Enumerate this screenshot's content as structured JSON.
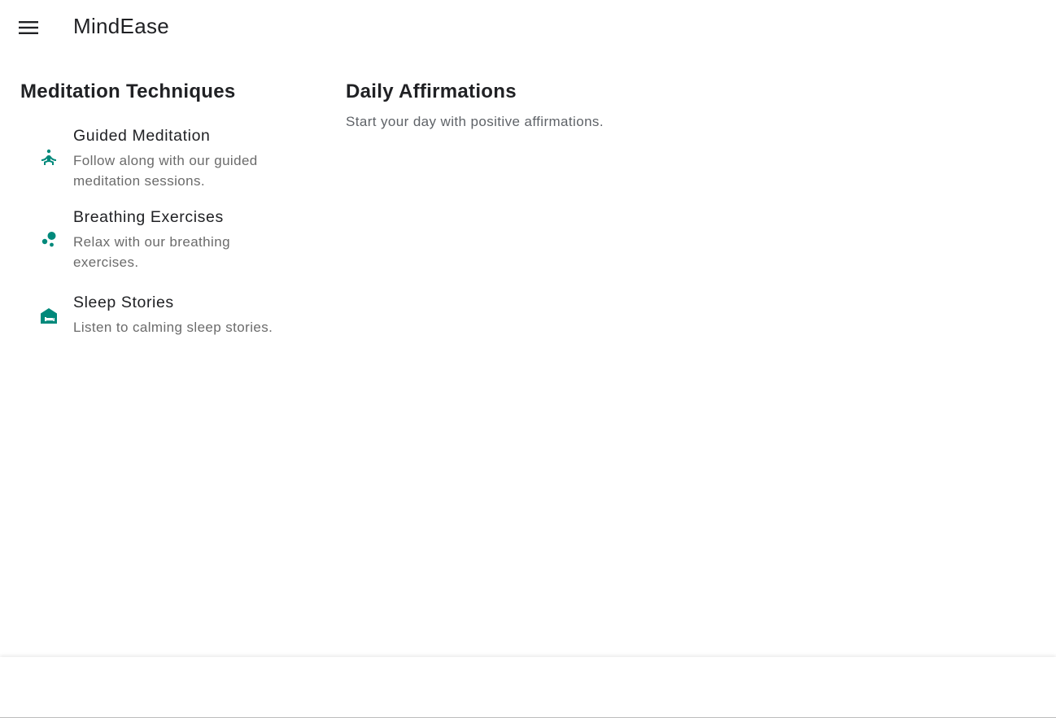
{
  "app": {
    "title": "MindEase",
    "menu_icon": "menu-icon"
  },
  "meditation": {
    "heading": "Meditation Techniques",
    "items": [
      {
        "icon": "self-improvement-icon",
        "title": "Guided Meditation",
        "description": "Follow along with our guided meditation sessions."
      },
      {
        "icon": "bubble-chart-icon",
        "title": "Breathing Exercises",
        "description": "Relax with our breathing exercises."
      },
      {
        "icon": "hotel-icon",
        "title": "Sleep Stories",
        "description": "Listen to calming sleep stories."
      }
    ]
  },
  "affirmations": {
    "heading": "Daily Affirmations",
    "text": "Start your day with positive affirmations."
  },
  "colors": {
    "accent": "#00897b",
    "text_primary": "#202124",
    "text_secondary": "#6b6b6b"
  }
}
